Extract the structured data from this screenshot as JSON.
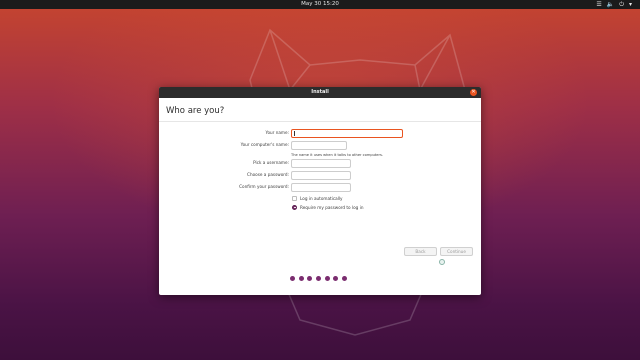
{
  "topbar": {
    "clock": "May 30  15:20",
    "tray_icons": [
      "network-icon",
      "volume-icon",
      "power-icon",
      "menu-arrow-icon"
    ]
  },
  "window": {
    "title": "Install",
    "heading": "Who are you?",
    "form": {
      "your_name_label": "Your name:",
      "your_name_value": "",
      "computer_name_label": "Your computer's name:",
      "computer_name_value": "",
      "computer_name_hint": "The name it uses when it talks to other computers.",
      "username_label": "Pick a username:",
      "username_value": "",
      "password_label": "Choose a password:",
      "password_value": "",
      "confirm_label": "Confirm your password:",
      "confirm_value": ""
    },
    "options": {
      "login_auto": "Log in automatically",
      "login_auto_selected": false,
      "require_password": "Require my password to log in",
      "require_password_selected": true
    },
    "buttons": {
      "back": "Back",
      "continue": "Continue"
    },
    "progress": {
      "steps": 7
    }
  },
  "colors": {
    "accent": "#e95420",
    "aubergine": "#7b2d6f"
  }
}
